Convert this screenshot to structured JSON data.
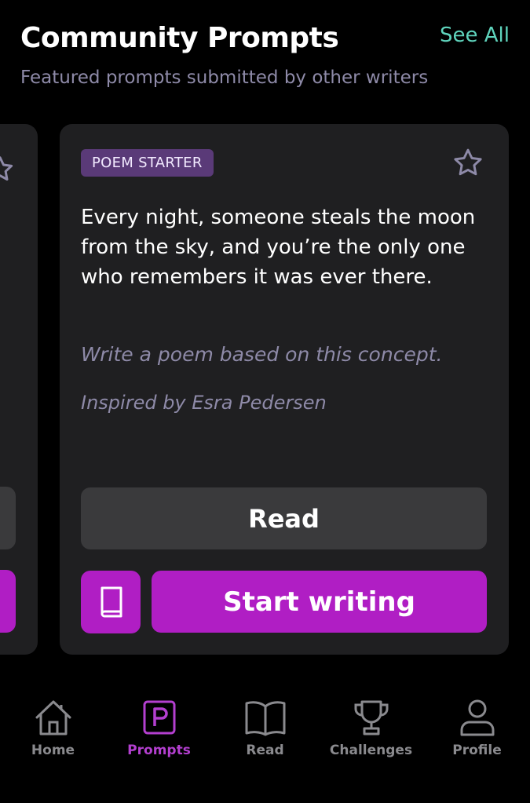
{
  "header": {
    "title": "Community Prompts",
    "see_all": "See All",
    "subtitle": "Featured prompts submitted by other writers"
  },
  "card": {
    "badge": "POEM STARTER",
    "prompt": "Every night, someone steals the moon from the sky, and you’re the only one who remembers it was ever there.",
    "instruction": "Write a poem based on this concept.",
    "inspired": "Inspired by Esra Pedersen",
    "read_label": "Read",
    "write_label": "Start writing"
  },
  "tabs": [
    {
      "label": "Home",
      "icon": "home-icon",
      "active": false
    },
    {
      "label": "Prompts",
      "icon": "prompts-icon",
      "active": true
    },
    {
      "label": "Read",
      "icon": "book-open-icon",
      "active": false
    },
    {
      "label": "Challenges",
      "icon": "trophy-icon",
      "active": false
    },
    {
      "label": "Profile",
      "icon": "person-icon",
      "active": false
    }
  ],
  "colors": {
    "accent": "#b01ec4",
    "see_all": "#5fd4bd",
    "muted_text": "#8e8aa8",
    "badge_bg": "#5a3a78",
    "card_bg": "#1f1f21",
    "secondary_button": "#3a3a3c",
    "tab_inactive": "#8a8a8e",
    "tab_active": "#b33fcf"
  }
}
